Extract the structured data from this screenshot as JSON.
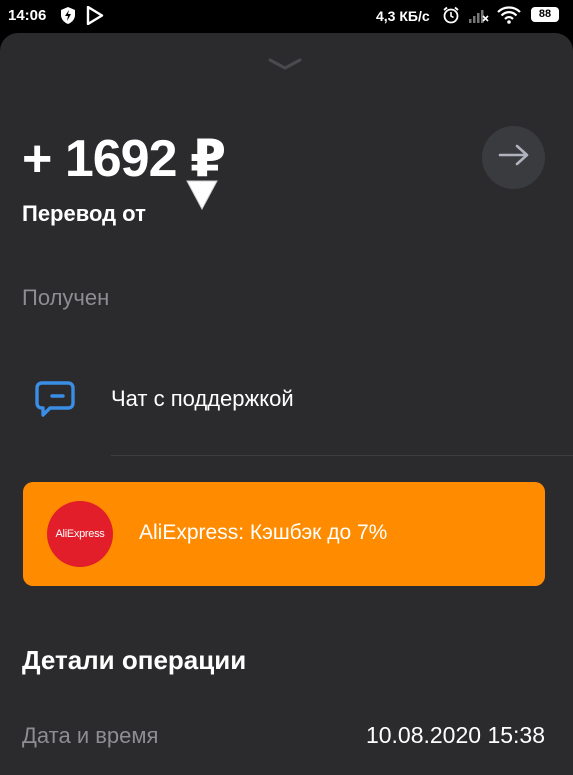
{
  "status_bar": {
    "time": "14:06",
    "network_speed": "4,3 КБ/с",
    "battery": "88",
    "icons": [
      "shield-icon",
      "play-store-icon",
      "alarm-icon",
      "no-signal-icon",
      "wifi-icon",
      "battery-icon"
    ]
  },
  "operation": {
    "amount": "+ 1692 ₽",
    "title": "Перевод от",
    "status": "Получен"
  },
  "support": {
    "chat_label": "Чат с поддержкой"
  },
  "promo": {
    "logo_text": "AliExpress",
    "text": "AliExpress: Кэшбэк до 7%",
    "color": "#ff8c00",
    "logo_color": "#e11e29"
  },
  "details": {
    "title": "Детали операции",
    "rows": [
      {
        "label": "Дата и время",
        "value": "10.08.2020 15:38"
      }
    ]
  },
  "colors": {
    "background": "#2b2b2d",
    "accent_blue": "#3a8ee6",
    "muted_text": "#8d8d92"
  }
}
